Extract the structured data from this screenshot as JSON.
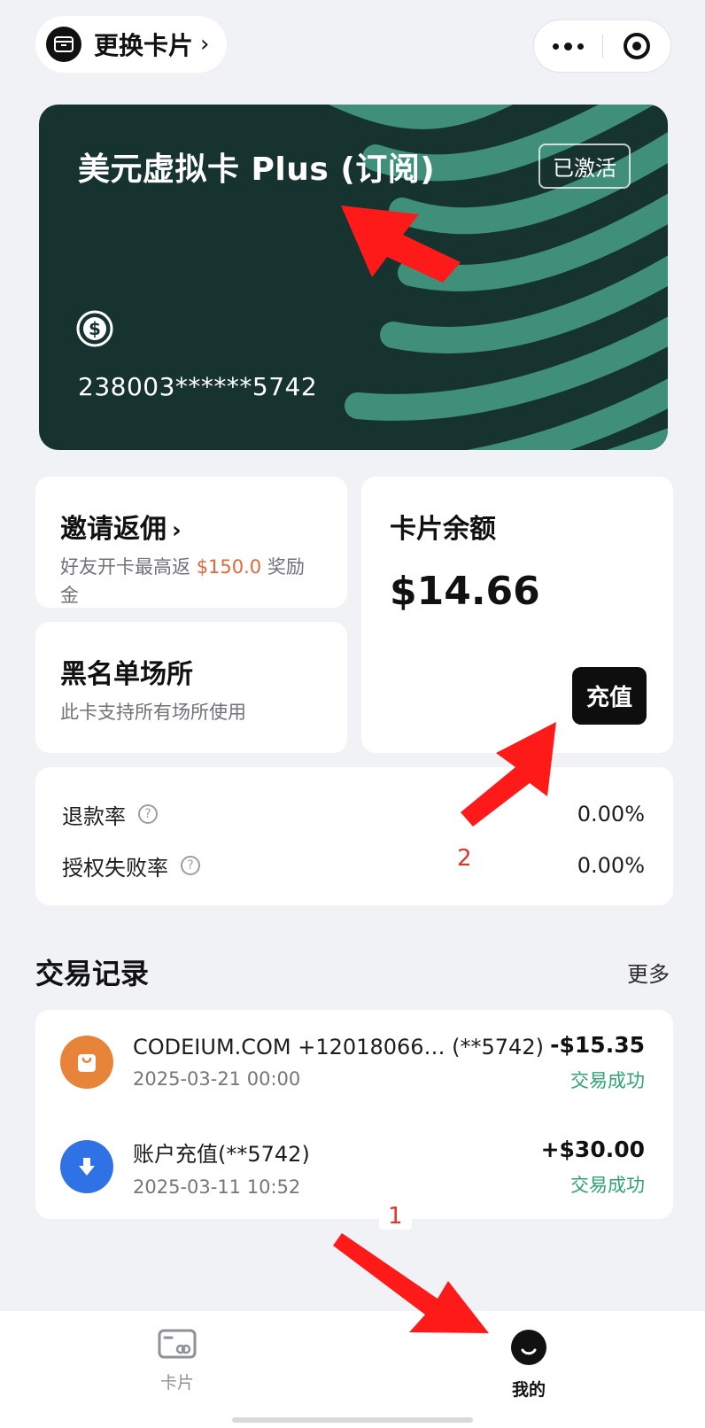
{
  "topbar": {
    "switch_card_label": "更换卡片",
    "switch_card_chevron": "›",
    "more_icon": "more-dots-icon",
    "close_icon": "target-close-icon"
  },
  "card": {
    "name": "美元虚拟卡 Plus (订阅)",
    "status": "已激活",
    "currency_icon": "dollar-coin-icon",
    "number": "238003******5742",
    "colors": {
      "background": "#163330",
      "stripes": "#3f8f7b"
    }
  },
  "invite": {
    "title": "邀请返佣",
    "chevron": "›",
    "desc_before": "好友开卡最高返 ",
    "desc_amount": "$150.0",
    "desc_after": " 奖励金"
  },
  "blacklist": {
    "title": "黑名单场所",
    "desc": "此卡支持所有场所使用"
  },
  "balance": {
    "title": "卡片余额",
    "amount": "$14.66",
    "topup_label": "充值"
  },
  "rates": {
    "refund_label": "退款率",
    "refund_value": "0.00%",
    "auth_fail_label": "授权失败率",
    "auth_fail_value": "0.00%",
    "help_glyph": "?"
  },
  "transactions": {
    "title": "交易记录",
    "more": "更多",
    "items": [
      {
        "name": "CODEIUM.COM +12018066…  (**5742)",
        "date": "2025-03-21 00:00",
        "amount": "-$15.35",
        "status": "交易成功",
        "icon": "shopping-bag-icon",
        "icon_color": "#e8843a"
      },
      {
        "name": "账户充值(**5742)",
        "date": "2025-03-11 10:52",
        "amount": "+$30.00",
        "status": "交易成功",
        "icon": "download-arrow-icon",
        "icon_color": "#2f72e6"
      }
    ]
  },
  "tabbar": {
    "tab_card_label": "卡片",
    "tab_card_icon": "card-icon",
    "tab_mine_label": "我的",
    "tab_mine_icon": "smile-face-icon"
  },
  "annotations": {
    "label_1": "1",
    "label_2": "2",
    "arrow_color": "#ff1a1a"
  }
}
